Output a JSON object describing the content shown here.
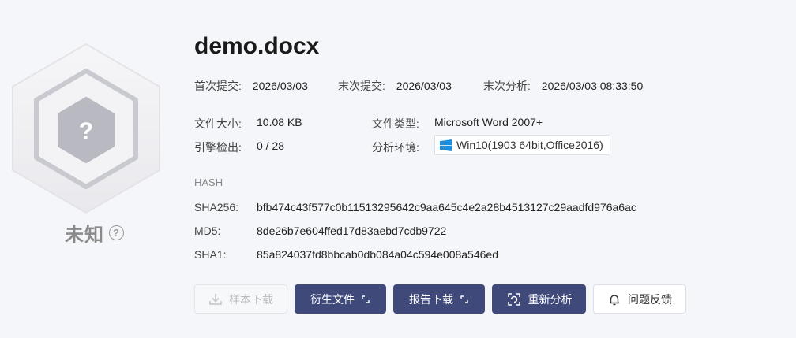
{
  "file": {
    "name": "demo.docx"
  },
  "verdict": {
    "label": "未知",
    "help_symbol": "?"
  },
  "submission": {
    "first_label": "首次提交:",
    "first_value": "2026/03/03",
    "last_label": "末次提交:",
    "last_value": "2026/03/03",
    "analysis_label": "末次分析:",
    "analysis_value": "2026/03/03 08:33:50"
  },
  "details": {
    "size_label": "文件大小:",
    "size_value": "10.08 KB",
    "type_label": "文件类型:",
    "type_value": "Microsoft Word 2007+",
    "detect_label": "引擎检出:",
    "detect_value": "0 / 28",
    "env_label": "分析环境:",
    "env_value": "Win10(1903 64bit,Office2016)"
  },
  "hash": {
    "title": "HASH",
    "sha256_label": "SHA256:",
    "sha256_value": "bfb474c43f577c0b11513295642c9aa645c4e2a28b4513127c29aadfd976a6ac",
    "md5_label": "MD5:",
    "md5_value": "8de26b7e604ffed17d83aebd7cdb9722",
    "sha1_label": "SHA1:",
    "sha1_value": "85a824037fd8bbcab0db084a04c594e008a546ed"
  },
  "actions": {
    "download_sample": "样本下载",
    "derived_files": "衍生文件",
    "download_report": "报告下载",
    "reanalyze": "重新分析",
    "feedback": "问题反馈"
  },
  "colors": {
    "primary": "#3f4a7a",
    "hex_outer": "#eeeef1",
    "hex_ring": "#cfd0d6",
    "hex_inner": "#b8b9c0"
  }
}
